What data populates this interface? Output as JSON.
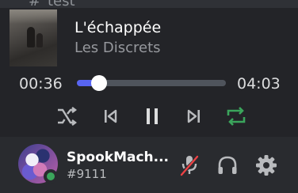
{
  "channel": {
    "hash": "#",
    "name": "test"
  },
  "player": {
    "track_title": "L'échappée",
    "track_artist": "Les Discrets",
    "time_current": "00:36",
    "time_duration": "04:03",
    "progress_fraction": 0.148,
    "controls": {
      "shuffle": "shuffle-icon",
      "previous": "skip-previous-icon",
      "pause": "pause-icon",
      "next": "skip-next-icon",
      "repeat": "repeat-icon"
    },
    "repeat_active_color": "#3ba55c",
    "progress_color": "#5865f2"
  },
  "user": {
    "username": "SpookMach...",
    "discriminator": "#9111",
    "status_color": "#3ba55c",
    "mic_muted": true,
    "mute_color": "#ed4245"
  }
}
